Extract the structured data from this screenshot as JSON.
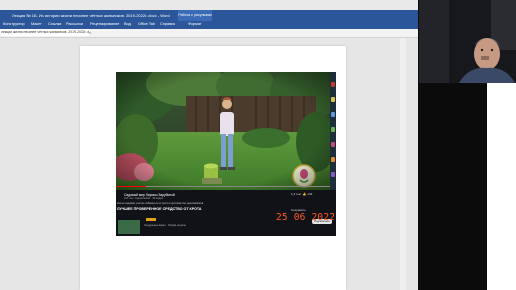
{
  "window": {
    "doc_title": "Лекция № 1Б. Из истории жизни несинее чётных жильников. 2019-2022г..docx - Word",
    "context_tab": "Работа с рисунками",
    "help_hint": "Что вы хотите сделать?"
  },
  "ribbon_tabs": [
    "Конструктор",
    "Макет",
    "Ссылки",
    "Рассылки",
    "Рецензирование",
    "Вид",
    "Office Tab",
    "Справка",
    "Формат"
  ],
  "doc_tab": {
    "label": "лекции жизни несинее чётных жильников. 2019-2022г..docx",
    "close_label": "×"
  },
  "video": {
    "channel_name": "Садовый мир Ларисы Зарубиной",
    "channel_sub": "217 тыс. подписчиков · 43 видео",
    "description": "Как на садовом участке избавиться от крота и кротовин без ядохимикатов",
    "headline": "ЛУЧШЕЕ ПРОВЕРЕННОЕ СРЕДСТВО ОТ КРОТА",
    "stats": "1,4 тыс.   👍 143",
    "stats2": "Сохранить",
    "subscribe_label": "Подписаться",
    "bottom_text": "Следующее видео · Огород на даче",
    "date_stamp": "25 06 2022"
  },
  "colors": {
    "word_blue": "#2b579a",
    "date_orange": "#ff5a1f"
  }
}
